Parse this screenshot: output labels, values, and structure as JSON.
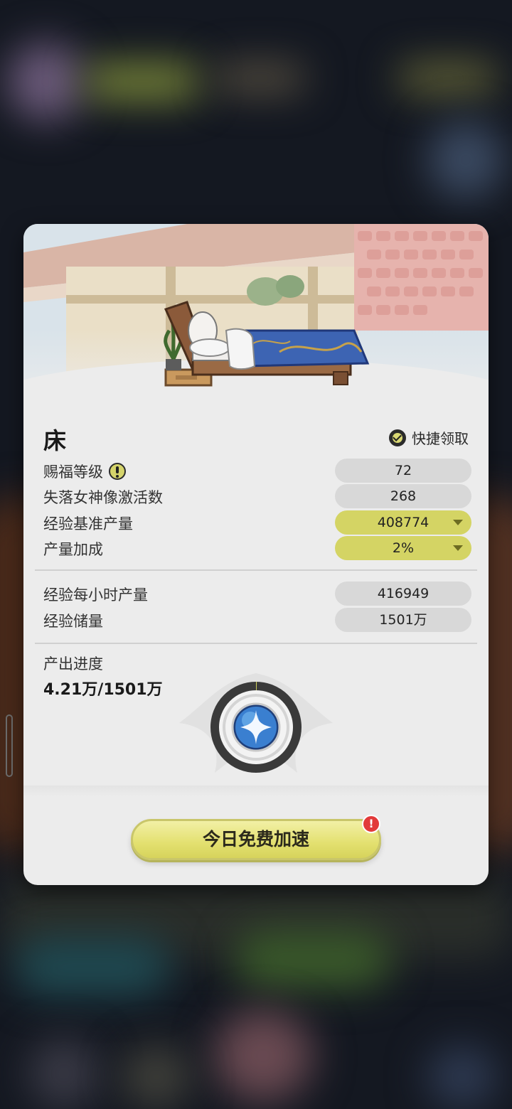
{
  "item": {
    "name": "床"
  },
  "quick_claim": {
    "label": "快捷领取"
  },
  "stats": [
    {
      "label": "赐福等级",
      "value": "72",
      "highlight": false,
      "has_info_icon": true
    },
    {
      "label": "失落女神像激活数",
      "value": "268",
      "highlight": false
    },
    {
      "label": "经验基准产量",
      "value": "408774",
      "highlight": true,
      "dropdown": true
    },
    {
      "label": "产量加成",
      "value": "2%",
      "highlight": true,
      "dropdown": true
    }
  ],
  "output": [
    {
      "label": "经验每小时产量",
      "value": "416949"
    },
    {
      "label": "经验储量",
      "value": "1501万"
    }
  ],
  "progress": {
    "label": "产出进度",
    "value_text": "4.21万/1501万",
    "current": 4.21,
    "total": 1501,
    "unit": "万"
  },
  "speedup_button": {
    "label": "今日免费加速",
    "badge": "!"
  },
  "colors": {
    "card_bg": "#ececec",
    "pill_gray": "#d8d8d8",
    "pill_yellow": "#d4d464",
    "button_yellow": "#e3e06f",
    "badge_red": "#e23a3a"
  },
  "icons": [
    "check-circle-icon",
    "warning-icon",
    "dropdown-caret-icon",
    "star-orb-icon",
    "alert-badge-icon"
  ]
}
